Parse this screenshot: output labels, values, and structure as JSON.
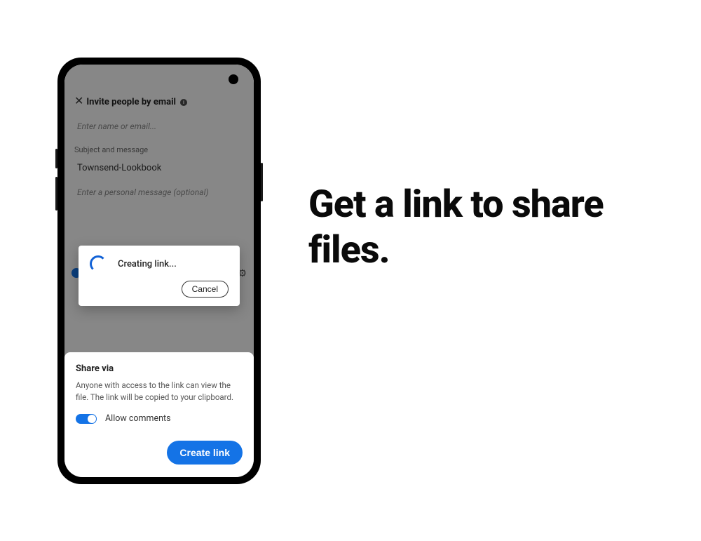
{
  "headline": "Get a link to share files.",
  "invite": {
    "title": "Invite people by email",
    "name_placeholder": "Enter name or email...",
    "section_label": "Subject and message",
    "subject_value": "Townsend-Lookbook",
    "message_placeholder": "Enter a personal message (optional)"
  },
  "modal": {
    "status": "Creating link...",
    "cancel": "Cancel"
  },
  "sheet": {
    "title": "Share via",
    "description": "Anyone with access to the link can view the file. The link will be copied to your clipboard.",
    "allow_comments": "Allow comments",
    "create": "Create link"
  }
}
